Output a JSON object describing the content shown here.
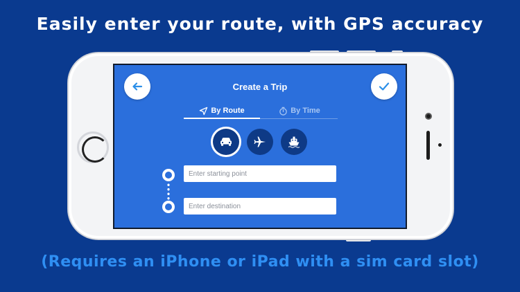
{
  "headline": "Easily enter your route, with GPS accuracy",
  "footnote": "(Requires an iPhone or iPad with a sim card slot)",
  "screen": {
    "title": "Create a Trip",
    "back_icon": "arrow-left-icon",
    "confirm_icon": "checkmark-icon",
    "tabs": [
      {
        "label": "By Route",
        "icon": "navigation-arrow-icon",
        "selected": true
      },
      {
        "label": "By Time",
        "icon": "stopwatch-icon",
        "selected": false
      }
    ],
    "modes": [
      {
        "icon": "car-icon",
        "selected": true
      },
      {
        "icon": "airplane-icon",
        "selected": false
      },
      {
        "icon": "ship-icon",
        "selected": false
      }
    ],
    "start_field": {
      "placeholder": "Enter starting point",
      "value": ""
    },
    "destination_field": {
      "placeholder": "Enter destination",
      "value": ""
    }
  },
  "colors": {
    "background": "#0a3a8f",
    "footnote": "#2f8ff3",
    "screen": "#2b6fdc",
    "mode_button": "#0e3a86",
    "accent_icon": "#2b8fe8"
  }
}
